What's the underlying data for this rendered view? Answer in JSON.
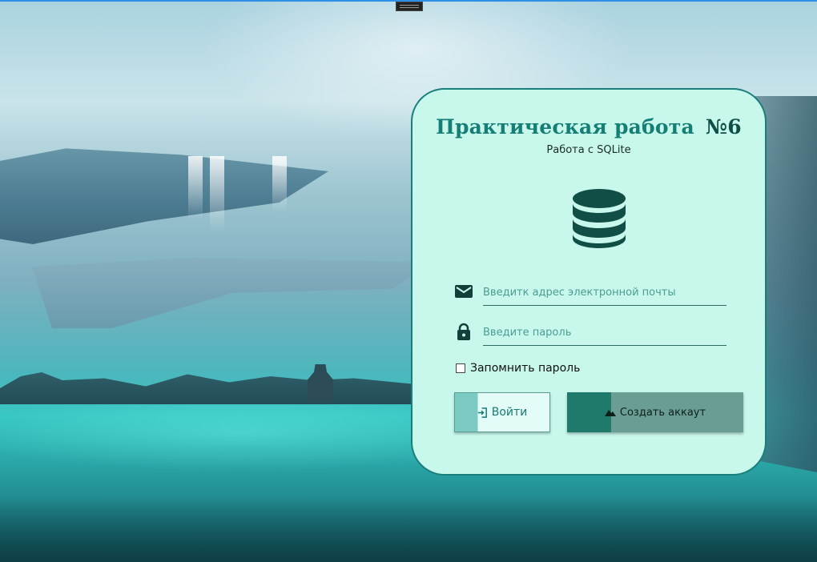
{
  "app": {
    "title": "Практическая работа",
    "title_number": "№6",
    "subtitle": "Работа с SQLite"
  },
  "icons": {
    "logo": "database-icon",
    "email": "mail-icon",
    "password": "lock-icon",
    "login": "login-icon",
    "create": "mountain-icon"
  },
  "form": {
    "email_placeholder": "Введитк адрес электронной почты",
    "email_value": "",
    "password_placeholder": "Введите пароль",
    "password_value": "",
    "remember_label": "Запомнить пароль",
    "remember_checked": false
  },
  "buttons": {
    "login_label": "Войти",
    "create_label": "Создать аккаут"
  },
  "colors": {
    "card_bg": "#c8f8ec",
    "card_border": "#1a7e7a",
    "accent": "#157f76",
    "accent_dark": "#0e4f47",
    "create_btn": "#6a9d93"
  }
}
